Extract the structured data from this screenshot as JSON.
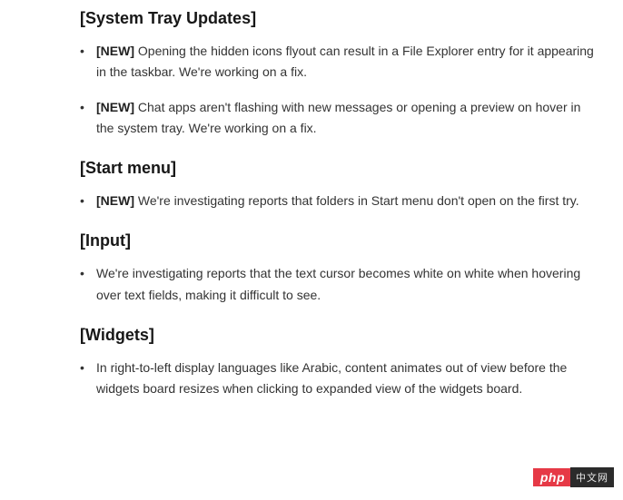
{
  "sections": [
    {
      "heading": "[System Tray Updates]",
      "items": [
        {
          "tag": "[NEW]",
          "text": "Opening the hidden icons flyout can result in a File Explorer entry for it appearing in the taskbar. We're working on a fix."
        },
        {
          "tag": "[NEW]",
          "text": "Chat apps aren't flashing with new messages or opening a preview on hover in the system tray. We're working on a fix."
        }
      ]
    },
    {
      "heading": "[Start menu]",
      "items": [
        {
          "tag": "[NEW]",
          "text": "We're investigating reports that folders in Start menu don't open on the first try."
        }
      ]
    },
    {
      "heading": "[Input]",
      "items": [
        {
          "tag": "",
          "text": "We're investigating reports that the text cursor becomes white on white when hovering over text fields, making it difficult to see."
        }
      ]
    },
    {
      "heading": "[Widgets]",
      "items": [
        {
          "tag": "",
          "text": "In right-to-left display languages like Arabic, content animates out of view before the widgets board resizes when clicking to expanded view of the widgets board."
        }
      ]
    }
  ],
  "badge": {
    "left": "php",
    "right": "中文网"
  }
}
